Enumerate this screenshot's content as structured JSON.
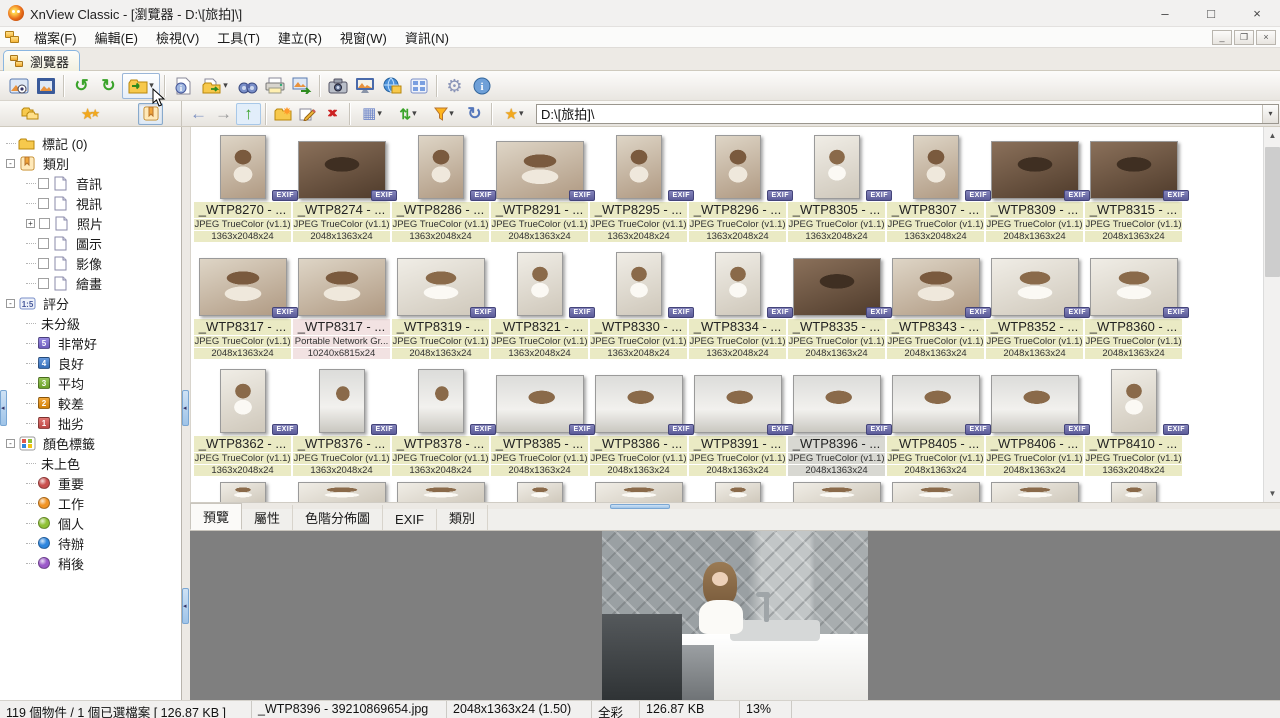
{
  "window": {
    "title": "XnView Classic - [瀏覽器 - D:\\[旅拍]\\]"
  },
  "menu": {
    "items": [
      "檔案(F)",
      "編輯(E)",
      "檢視(V)",
      "工具(T)",
      "建立(R)",
      "視窗(W)",
      "資訊(N)"
    ]
  },
  "main_tab": {
    "label": "瀏覽器"
  },
  "icons": {
    "rotate_left": "↺",
    "rotate_right": "↻",
    "back": "←",
    "forward": "→",
    "up": "↑",
    "delete": "×",
    "grid": "▦",
    "sort": "⇅",
    "refresh": "↻",
    "star": "★",
    "caret": "▾",
    "settings": "⚙",
    "scroll_up": "▲",
    "scroll_down": "▼",
    "minimize": "–",
    "maximize": "□",
    "close": "×",
    "mdi_minimize": "_",
    "mdi_restore": "❐",
    "mdi_close": "×"
  },
  "address": {
    "value": "D:\\[旅拍]\\"
  },
  "sidebar": {
    "rows": [
      {
        "depth": 0,
        "icon": "folder",
        "label": "標記 (0)"
      },
      {
        "depth": 0,
        "expander": "-",
        "icon": "book",
        "label": "類別"
      },
      {
        "depth": 1,
        "checkbox": true,
        "icon": "page",
        "label": "音訊"
      },
      {
        "depth": 1,
        "checkbox": true,
        "icon": "page",
        "label": "視訊"
      },
      {
        "depth": 1,
        "expander": "+",
        "checkbox": true,
        "icon": "page",
        "label": "照片"
      },
      {
        "depth": 1,
        "checkbox": true,
        "icon": "page",
        "label": "圖示"
      },
      {
        "depth": 1,
        "checkbox": true,
        "icon": "page",
        "label": "影像"
      },
      {
        "depth": 1,
        "checkbox": true,
        "icon": "page",
        "label": "繪畫"
      },
      {
        "depth": 0,
        "expander": "-",
        "icon": "rating",
        "label": "評分"
      },
      {
        "depth": 1,
        "label": "未分級"
      },
      {
        "depth": 1,
        "badge": "5",
        "badgeColor": "#7e6bd9",
        "label": "非常好"
      },
      {
        "depth": 1,
        "badge": "4",
        "badgeColor": "#3f7fd4",
        "label": "良好"
      },
      {
        "depth": 1,
        "badge": "3",
        "badgeColor": "#7cb82f",
        "label": "平均"
      },
      {
        "depth": 1,
        "badge": "2",
        "badgeColor": "#f0930a",
        "label": "較差"
      },
      {
        "depth": 1,
        "badge": "1",
        "badgeColor": "#d9534f",
        "label": "拙劣"
      },
      {
        "depth": 0,
        "expander": "-",
        "icon": "colors",
        "label": "顏色標籤"
      },
      {
        "depth": 1,
        "label": "未上色"
      },
      {
        "depth": 1,
        "dot": "#c9504e",
        "label": "重要"
      },
      {
        "depth": 1,
        "dot": "#f19425",
        "label": "工作"
      },
      {
        "depth": 1,
        "dot": "#8fc135",
        "label": "個人"
      },
      {
        "depth": 1,
        "dot": "#2e86de",
        "label": "待辦"
      },
      {
        "depth": 1,
        "dot": "#9b59c9",
        "label": "稍後"
      }
    ]
  },
  "browser": {
    "items": [
      {
        "name": "_WTP8270 - ...",
        "format": "JPEG TrueColor (v1.1)",
        "dims": "1363x2048x24",
        "orient": "portrait",
        "tone": "warm",
        "exif": true
      },
      {
        "name": "_WTP8274 - ...",
        "format": "JPEG TrueColor (v1.1)",
        "dims": "2048x1363x24",
        "orient": "landscape",
        "tone": "dark",
        "exif": true
      },
      {
        "name": "_WTP8286 - ...",
        "format": "JPEG TrueColor (v1.1)",
        "dims": "1363x2048x24",
        "orient": "portrait",
        "tone": "warm",
        "exif": true
      },
      {
        "name": "_WTP8291 - ...",
        "format": "JPEG TrueColor (v1.1)",
        "dims": "2048x1363x24",
        "orient": "landscape",
        "tone": "warm",
        "exif": true
      },
      {
        "name": "_WTP8295 - ...",
        "format": "JPEG TrueColor (v1.1)",
        "dims": "1363x2048x24",
        "orient": "portrait",
        "tone": "warm",
        "exif": true
      },
      {
        "name": "_WTP8296 - ...",
        "format": "JPEG TrueColor (v1.1)",
        "dims": "1363x2048x24",
        "orient": "portrait",
        "tone": "warm",
        "exif": true
      },
      {
        "name": "_WTP8305 - ...",
        "format": "JPEG TrueColor (v1.1)",
        "dims": "1363x2048x24",
        "orient": "portrait",
        "tone": "light",
        "exif": true
      },
      {
        "name": "_WTP8307 - ...",
        "format": "JPEG TrueColor (v1.1)",
        "dims": "1363x2048x24",
        "orient": "portrait",
        "tone": "warm",
        "exif": true
      },
      {
        "name": "_WTP8309 - ...",
        "format": "JPEG TrueColor (v1.1)",
        "dims": "2048x1363x24",
        "orient": "landscape",
        "tone": "dark",
        "exif": true
      },
      {
        "name": "_WTP8315 - ...",
        "format": "JPEG TrueColor (v1.1)",
        "dims": "2048x1363x24",
        "orient": "landscape",
        "tone": "dark",
        "exif": true
      },
      {
        "name": "_WTP8317 - ...",
        "format": "JPEG TrueColor (v1.1)",
        "dims": "2048x1363x24",
        "orient": "landscape",
        "tone": "warm",
        "exif": true
      },
      {
        "name": "_WTP8317 - ...",
        "format": "Portable Network Gr...",
        "dims": "10240x6815x24",
        "orient": "landscape",
        "tone": "warm",
        "exif": false,
        "variant": "png"
      },
      {
        "name": "_WTP8319 - ...",
        "format": "JPEG TrueColor (v1.1)",
        "dims": "2048x1363x24",
        "orient": "landscape",
        "tone": "light",
        "exif": true
      },
      {
        "name": "_WTP8321 - ...",
        "format": "JPEG TrueColor (v1.1)",
        "dims": "1363x2048x24",
        "orient": "portrait",
        "tone": "light",
        "exif": true
      },
      {
        "name": "_WTP8330 - ...",
        "format": "JPEG TrueColor (v1.1)",
        "dims": "1363x2048x24",
        "orient": "portrait",
        "tone": "light",
        "exif": true
      },
      {
        "name": "_WTP8334 - ...",
        "format": "JPEG TrueColor (v1.1)",
        "dims": "1363x2048x24",
        "orient": "portrait",
        "tone": "light",
        "exif": true
      },
      {
        "name": "_WTP8335 - ...",
        "format": "JPEG TrueColor (v1.1)",
        "dims": "2048x1363x24",
        "orient": "landscape",
        "tone": "dark",
        "exif": true
      },
      {
        "name": "_WTP8343 - ...",
        "format": "JPEG TrueColor (v1.1)",
        "dims": "2048x1363x24",
        "orient": "landscape",
        "tone": "warm",
        "exif": true
      },
      {
        "name": "_WTP8352 - ...",
        "format": "JPEG TrueColor (v1.1)",
        "dims": "2048x1363x24",
        "orient": "landscape",
        "tone": "light",
        "exif": true
      },
      {
        "name": "_WTP8360 - ...",
        "format": "JPEG TrueColor (v1.1)",
        "dims": "2048x1363x24",
        "orient": "landscape",
        "tone": "light",
        "exif": true
      },
      {
        "name": "_WTP8362 - ...",
        "format": "JPEG TrueColor (v1.1)",
        "dims": "1363x2048x24",
        "orient": "portrait",
        "tone": "light",
        "exif": true
      },
      {
        "name": "_WTP8376 - ...",
        "format": "JPEG TrueColor (v1.1)",
        "dims": "1363x2048x24",
        "orient": "portrait",
        "tone": "kitchen",
        "exif": true
      },
      {
        "name": "_WTP8378 - ...",
        "format": "JPEG TrueColor (v1.1)",
        "dims": "1363x2048x24",
        "orient": "portrait",
        "tone": "kitchen",
        "exif": true
      },
      {
        "name": "_WTP8385 - ...",
        "format": "JPEG TrueColor (v1.1)",
        "dims": "2048x1363x24",
        "orient": "landscape",
        "tone": "kitchen",
        "exif": true
      },
      {
        "name": "_WTP8386 - ...",
        "format": "JPEG TrueColor (v1.1)",
        "dims": "2048x1363x24",
        "orient": "landscape",
        "tone": "kitchen",
        "exif": true
      },
      {
        "name": "_WTP8391 - ...",
        "format": "JPEG TrueColor (v1.1)",
        "dims": "2048x1363x24",
        "orient": "landscape",
        "tone": "kitchen",
        "exif": true
      },
      {
        "name": "_WTP8396 - ...",
        "format": "JPEG TrueColor (v1.1)",
        "dims": "2048x1363x24",
        "orient": "landscape",
        "tone": "kitchen",
        "exif": true,
        "variant": "selected"
      },
      {
        "name": "_WTP8405 - ...",
        "format": "JPEG TrueColor (v1.1)",
        "dims": "2048x1363x24",
        "orient": "landscape",
        "tone": "kitchen",
        "exif": true
      },
      {
        "name": "_WTP8406 - ...",
        "format": "JPEG TrueColor (v1.1)",
        "dims": "2048x1363x24",
        "orient": "landscape",
        "tone": "kitchen",
        "exif": true
      },
      {
        "name": "_WTP8410 - ...",
        "format": "JPEG TrueColor (v1.1)",
        "dims": "1363x2048x24",
        "orient": "portrait",
        "tone": "light",
        "exif": true
      }
    ],
    "exif_badge": "EXIF"
  },
  "bottom_panel": {
    "tabs": [
      "預覽",
      "屬性",
      "色階分佈圖",
      "EXIF",
      "類別"
    ],
    "active_tab": "預覽"
  },
  "statusbar": {
    "segments": [
      "119 個物件 / 1 個已選檔案  [ 126.87 KB ]",
      "_WTP8396 - 39210869654.jpg",
      "2048x1363x24 (1.50)",
      "全彩",
      "126.87 KB",
      "13%"
    ]
  }
}
